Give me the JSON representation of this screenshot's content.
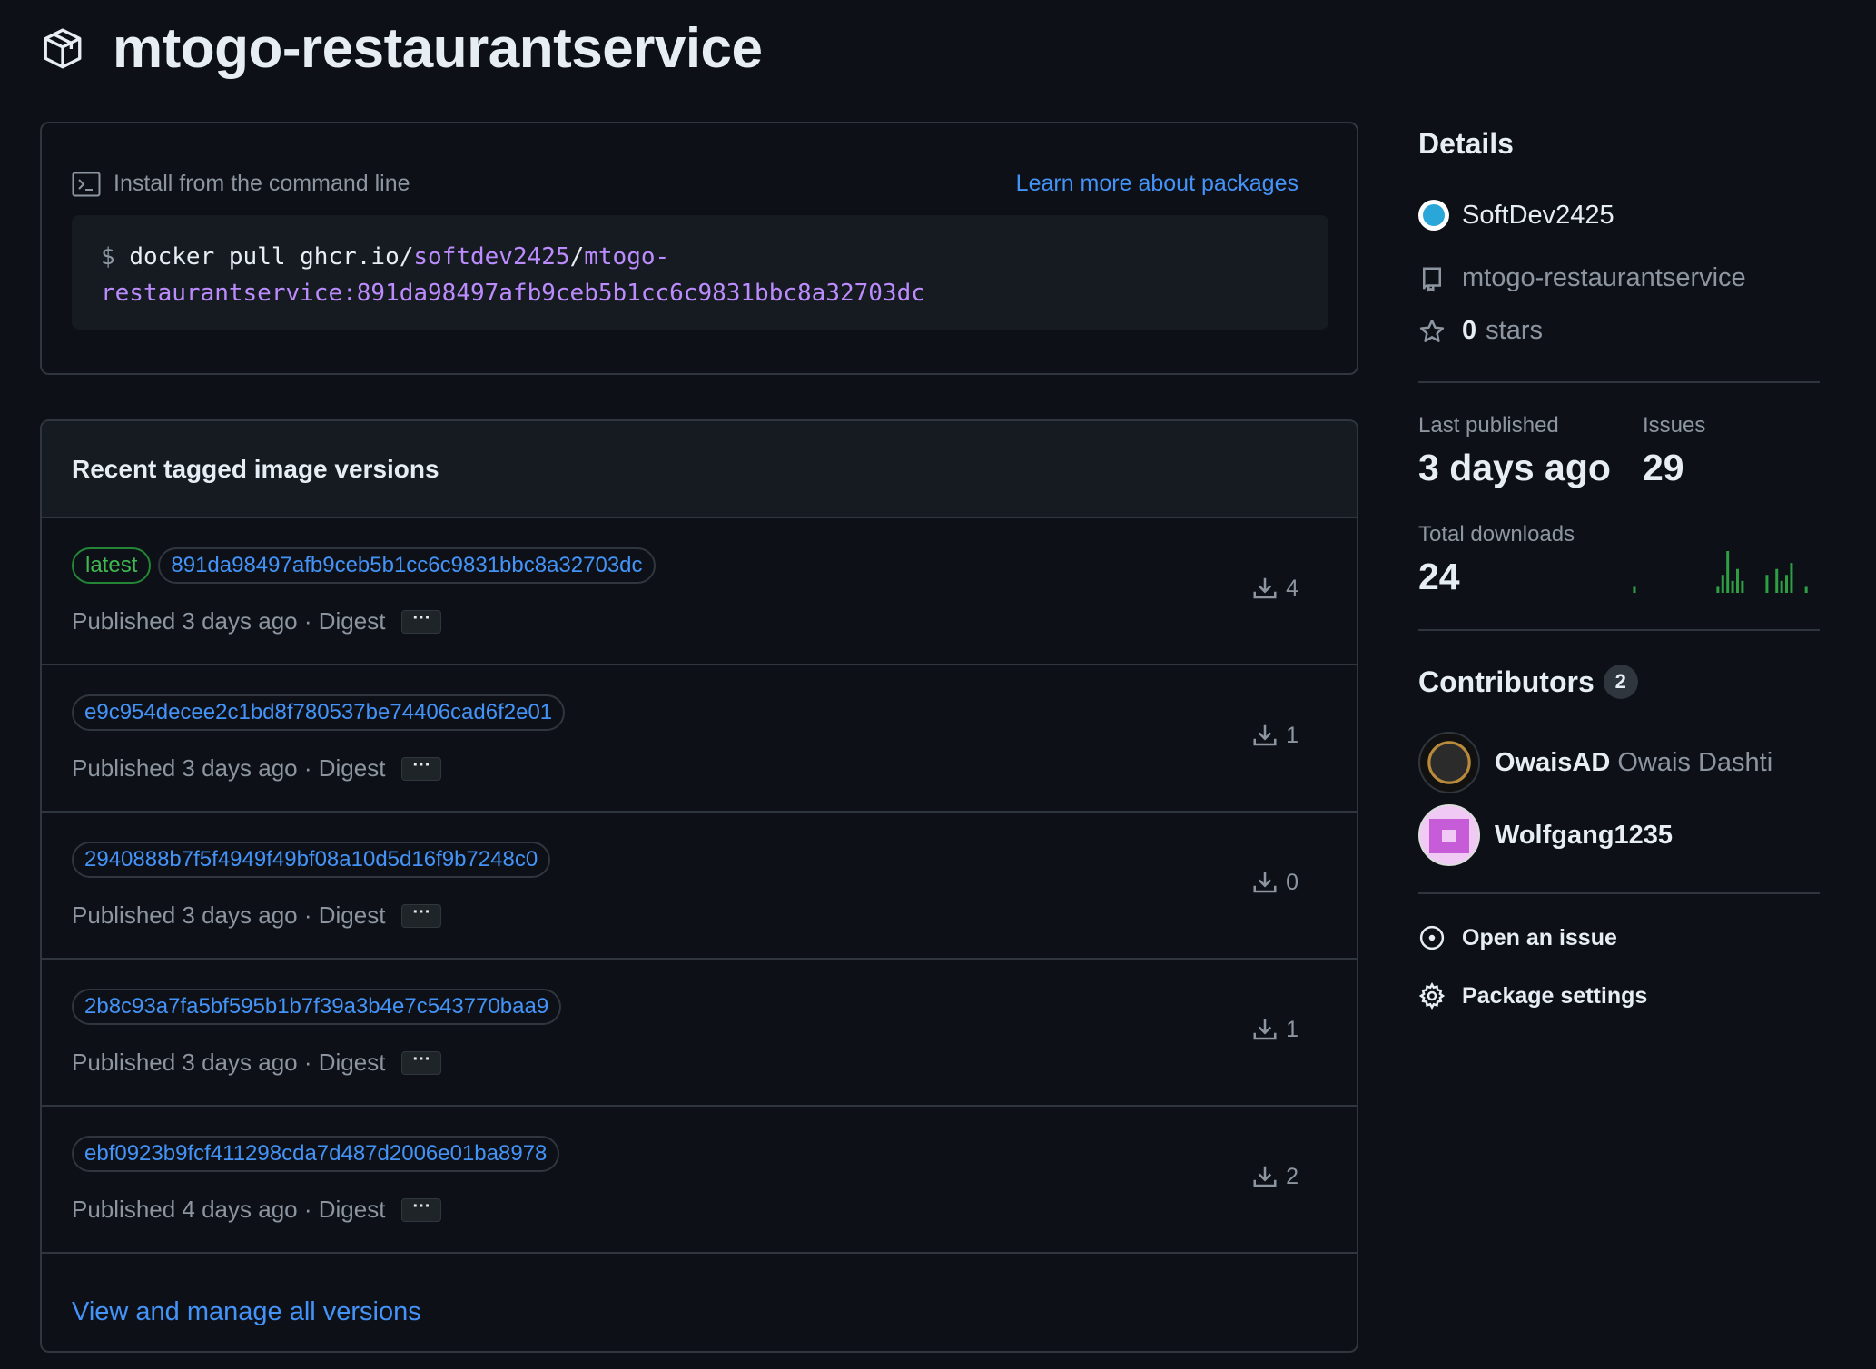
{
  "header": {
    "title": "mtogo-restaurantservice",
    "icon": "package-icon"
  },
  "install": {
    "label": "Install from the command line",
    "learn_link": "Learn more about packages",
    "prompt": "$",
    "cmd_prefix": "docker pull ghcr.io/",
    "cmd_owner": "softdev2425",
    "cmd_sep": "/",
    "cmd_image_line1": "mtogo-",
    "cmd_image_line2": "restaurantservice:891da98497afb9ceb5b1cc6c9831bbc8a32703dc"
  },
  "versions": {
    "title": "Recent tagged image versions",
    "view_all": "View and manage all versions",
    "ellipsis": "···",
    "rows": [
      {
        "tag": "latest",
        "hash": "891da98497afb9ceb5b1cc6c9831bbc8a32703dc",
        "published": "Published 3 days ago · Digest",
        "downloads": "4"
      },
      {
        "tag": null,
        "hash": "e9c954decee2c1bd8f780537be74406cad6f2e01",
        "published": "Published 3 days ago · Digest",
        "downloads": "1"
      },
      {
        "tag": null,
        "hash": "2940888b7f5f4949f49bf08a10d5d16f9b7248c0",
        "published": "Published 3 days ago · Digest",
        "downloads": "0"
      },
      {
        "tag": null,
        "hash": "2b8c93a7fa5bf595b1b7f39a3b4e7c543770baa9",
        "published": "Published 3 days ago · Digest",
        "downloads": "1"
      },
      {
        "tag": null,
        "hash": "ebf0923b9fcf411298cda7d487d2006e01ba8978",
        "published": "Published 4 days ago · Digest",
        "downloads": "2"
      }
    ]
  },
  "details": {
    "title": "Details",
    "owner": "SoftDev2425",
    "repo": "mtogo-restaurantservice",
    "stars_count": "0",
    "stars_label": "stars"
  },
  "stats": {
    "last_published_label": "Last published",
    "last_published_value": "3 days ago",
    "issues_label": "Issues",
    "issues_value": "29",
    "total_downloads_label": "Total downloads",
    "total_downloads_value": "24",
    "sparkline_color": "#2ea043",
    "sparkline": [
      0,
      1,
      0,
      0,
      0,
      0,
      0,
      0,
      0,
      0,
      0,
      0,
      0,
      0,
      0,
      0,
      0,
      0,
      1,
      3,
      7,
      2,
      4,
      2,
      0,
      0,
      0,
      0,
      3,
      0,
      4,
      2,
      3,
      5,
      0,
      0,
      1
    ]
  },
  "contributors": {
    "title": "Contributors",
    "count": "2",
    "list": [
      {
        "username": "OwaisAD",
        "fullname": "Owais Dashti"
      },
      {
        "username": "Wolfgang1235",
        "fullname": ""
      }
    ]
  },
  "actions": {
    "open_issue": "Open an issue",
    "package_settings": "Package settings"
  },
  "colors": {
    "background": "#0d1117",
    "link": "#4493f8",
    "border": "#30363d",
    "accent_purple": "#bc8cff",
    "tag_green": "#3fb950"
  }
}
